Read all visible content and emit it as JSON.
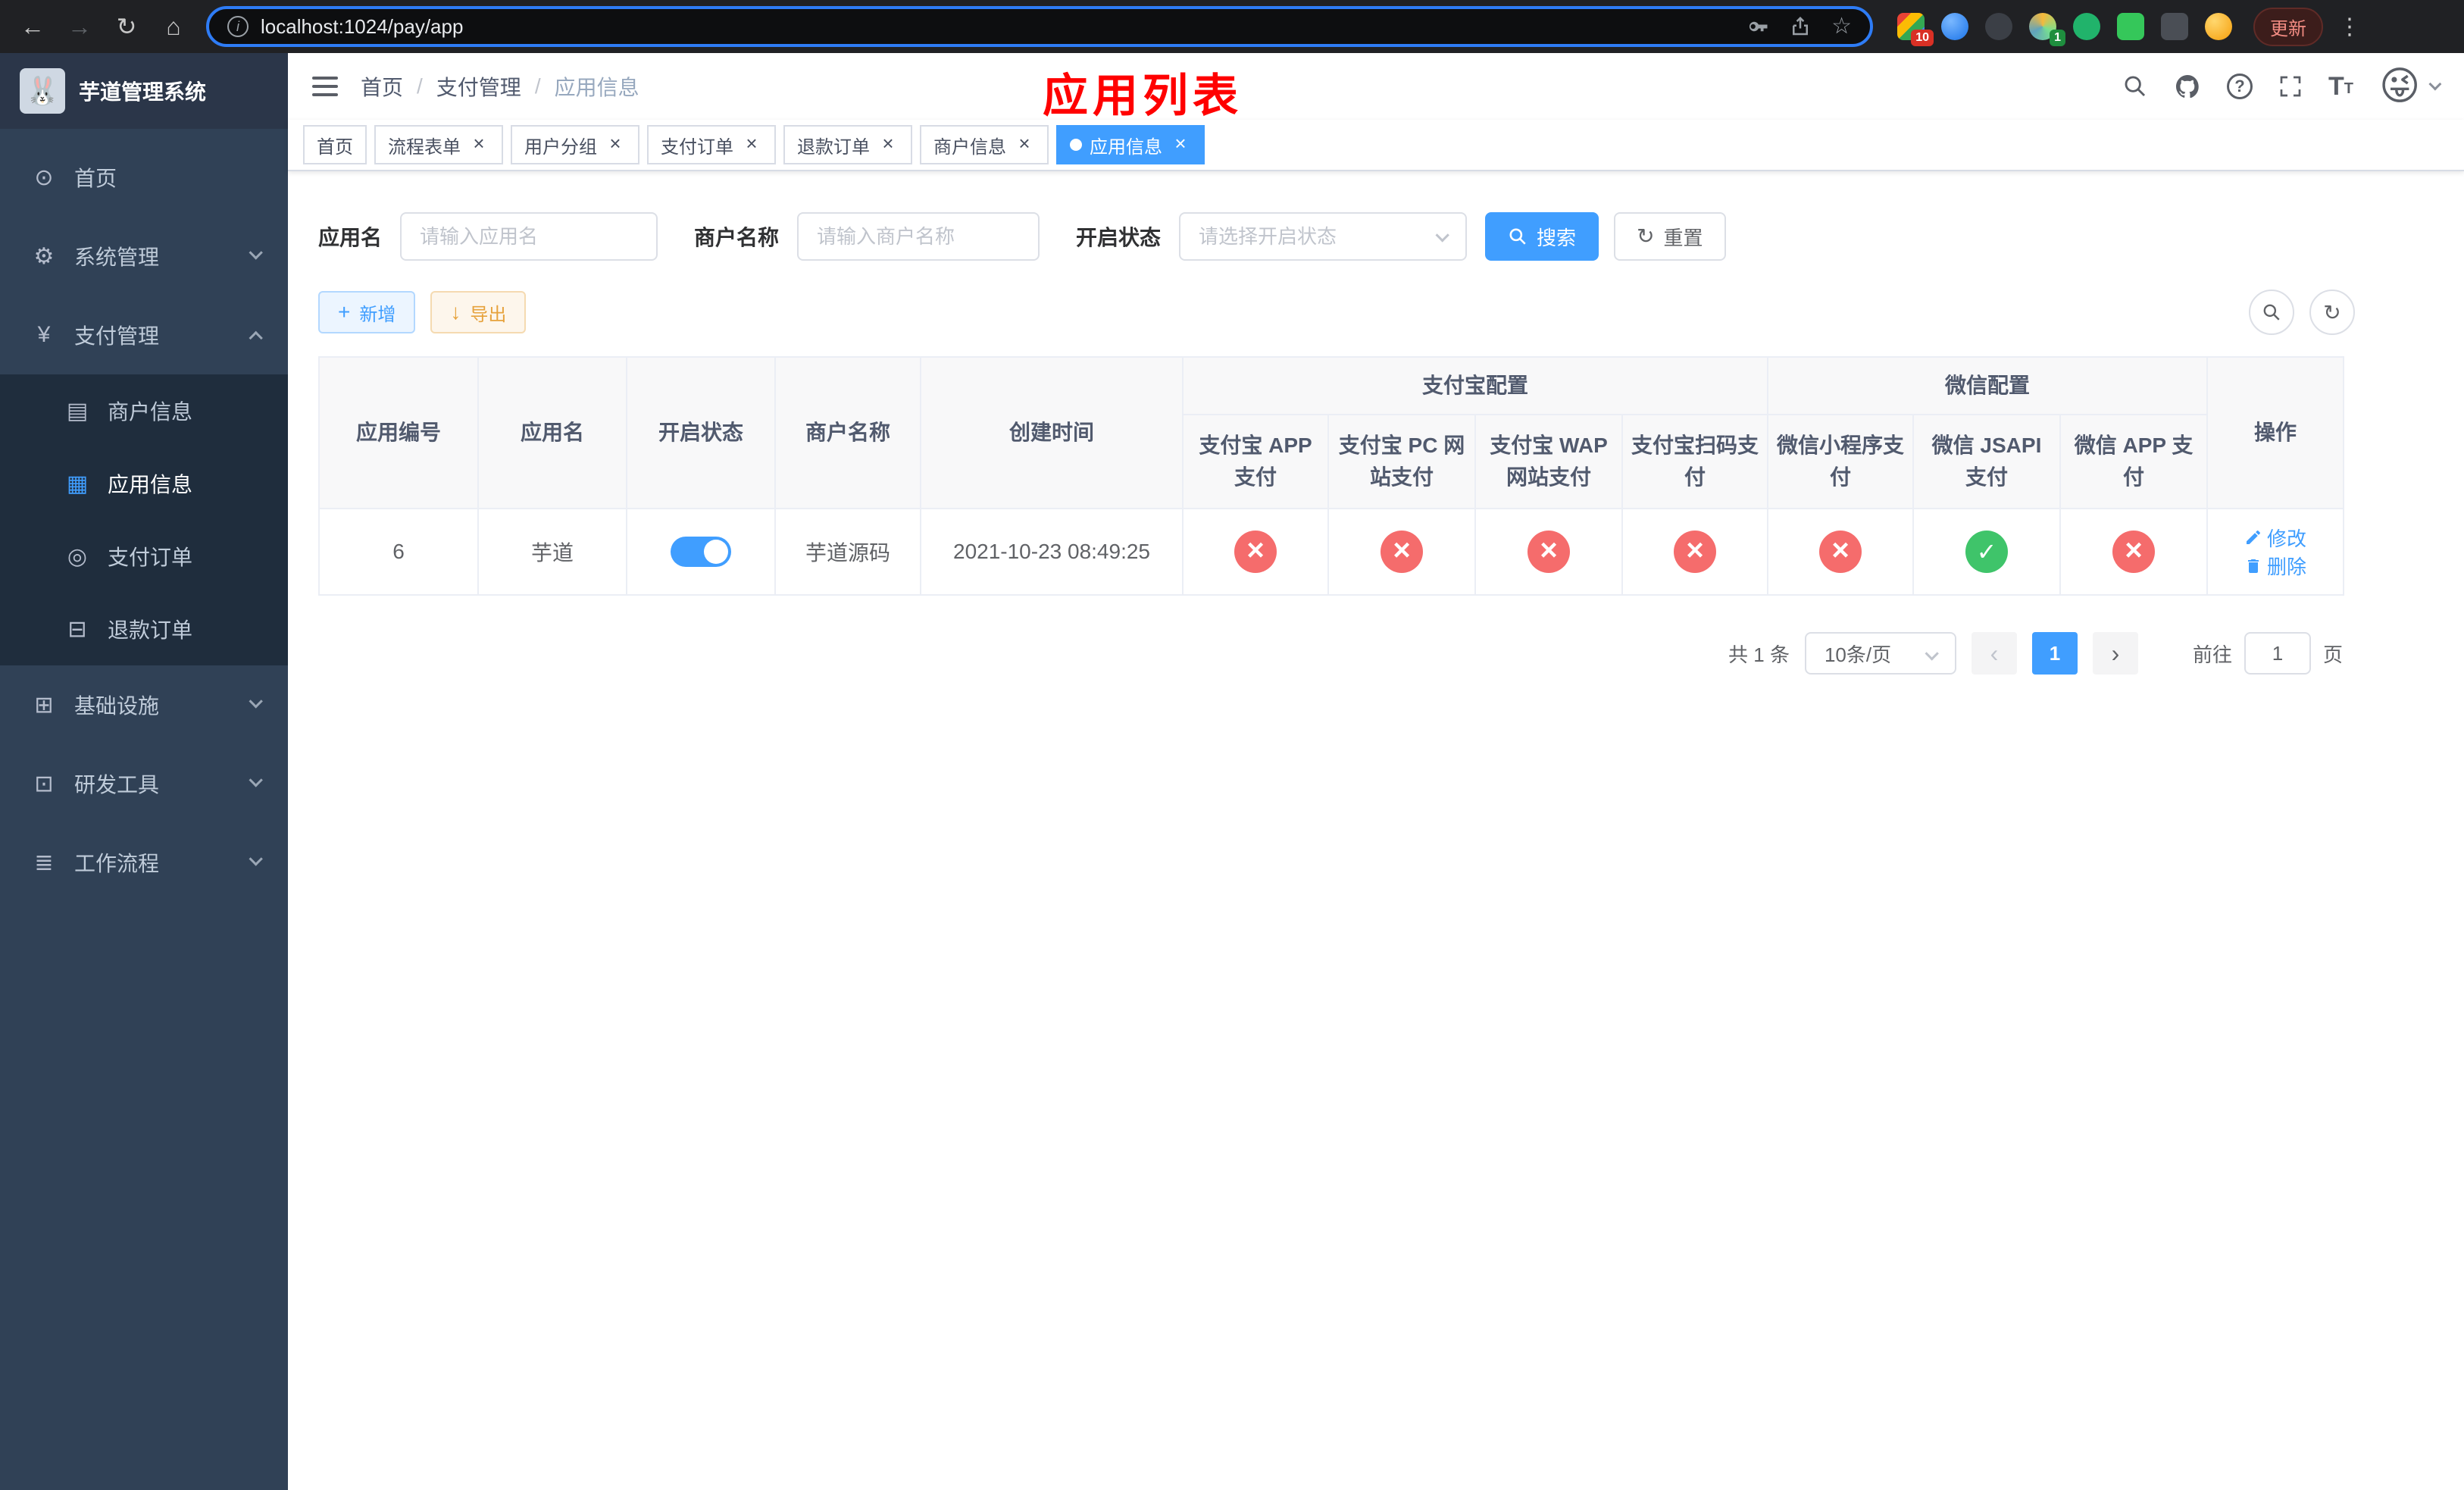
{
  "browser": {
    "url": "localhost:1024/pay/app",
    "update_label": "更新",
    "ext_badge_first": "10",
    "ext_badge_fourth": "1"
  },
  "icons": {
    "back": "←",
    "forward": "→",
    "reload": "↻",
    "home": "⌂",
    "info": "i",
    "star": "☆",
    "menu_dots": "⋮",
    "rabbit_avatar": "🐰",
    "dashboard": "⊙",
    "gear": "⚙",
    "yen": "¥",
    "merchant": "▤",
    "app_grid": "▦",
    "order": "◎",
    "refund": "⊟",
    "infra": "⊞",
    "devtool": "⊡",
    "workflow": "≣",
    "question": "?",
    "avatar_emoji": "😜",
    "plus": "+",
    "download": "↓",
    "refresh": "↻",
    "close": "×",
    "prev": "‹",
    "next": "›"
  },
  "sidebar": {
    "app_title": "芋道管理系统",
    "items": [
      {
        "label": "首页"
      },
      {
        "label": "系统管理"
      },
      {
        "label": "支付管理"
      },
      {
        "label": "基础设施"
      },
      {
        "label": "研发工具"
      },
      {
        "label": "工作流程"
      }
    ],
    "payment_children": [
      {
        "label": "商户信息"
      },
      {
        "label": "应用信息"
      },
      {
        "label": "支付订单"
      },
      {
        "label": "退款订单"
      }
    ]
  },
  "header": {
    "breadcrumb": [
      "首页",
      "支付管理",
      "应用信息"
    ],
    "title": "应用列表"
  },
  "tabs": [
    {
      "label": "首页"
    },
    {
      "label": "流程表单"
    },
    {
      "label": "用户分组"
    },
    {
      "label": "支付订单"
    },
    {
      "label": "退款订单"
    },
    {
      "label": "商户信息"
    },
    {
      "label": "应用信息"
    }
  ],
  "filters": {
    "app_name": {
      "label": "应用名",
      "placeholder": "请输入应用名"
    },
    "merchant_name": {
      "label": "商户名称",
      "placeholder": "请输入商户名称"
    },
    "status": {
      "label": "开启状态",
      "placeholder": "请选择开启状态"
    },
    "search_label": "搜索",
    "reset_label": "重置"
  },
  "toolbar": {
    "add_label": "新增",
    "export_label": "导出"
  },
  "table": {
    "headers": {
      "id": "应用编号",
      "name": "应用名",
      "status": "开启状态",
      "merchant": "商户名称",
      "created": "创建时间",
      "alipay_group": "支付宝配置",
      "wechat_group": "微信配置",
      "actions": "操作",
      "alipay_app": "支付宝 APP 支付",
      "alipay_pc": "支付宝 PC 网站支付",
      "alipay_wap": "支付宝 WAP 网站支付",
      "alipay_scan": "支付宝扫码支付",
      "wx_mini": "微信小程序支付",
      "wx_jsapi": "微信 JSAPI 支付",
      "wx_app": "微信 APP 支付"
    },
    "rows": [
      {
        "id": "6",
        "name": "芋道",
        "enabled": true,
        "merchant": "芋道源码",
        "created": "2021-10-23 08:49:25",
        "alipay_app": false,
        "alipay_pc": false,
        "alipay_wap": false,
        "alipay_scan": false,
        "wx_mini": false,
        "wx_jsapi": true,
        "wx_app": false,
        "edit_label": "修改",
        "delete_label": "删除"
      }
    ]
  },
  "pagination": {
    "total": "共 1 条",
    "page_size": "10条/页",
    "current": "1",
    "goto_prefix": "前往",
    "goto_value": "1",
    "goto_suffix": "页"
  }
}
